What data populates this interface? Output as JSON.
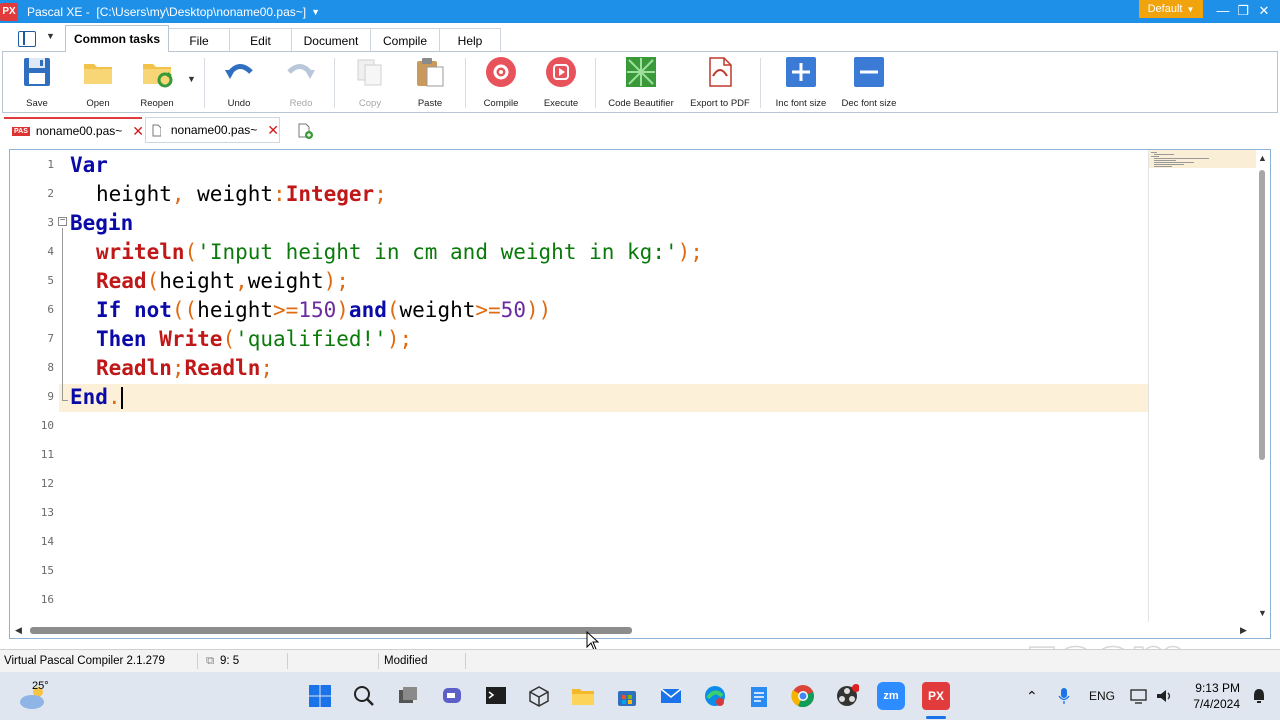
{
  "window": {
    "logo": "PX",
    "app_name": "Pascal XE",
    "path": "[C:\\Users\\my\\Desktop\\noname00.pas~]",
    "theme": "Default"
  },
  "ribbon_tabs": [
    "Common tasks",
    "File",
    "Edit",
    "Document",
    "Compile",
    "Help"
  ],
  "toolbar": {
    "save": "Save",
    "open": "Open",
    "reopen": "Reopen",
    "undo": "Undo",
    "redo": "Redo",
    "copy": "Copy",
    "paste": "Paste",
    "compile": "Compile",
    "execute": "Execute",
    "beautifier": "Code Beautifier",
    "export_pdf": "Export to PDF",
    "inc_font": "Inc font size",
    "dec_font": "Dec font size"
  },
  "doc_tabs": [
    {
      "label": "noname00.pas~",
      "active": true,
      "badge": "PAS"
    },
    {
      "label": "noname00.pas~",
      "active": false
    }
  ],
  "editor": {
    "line_numbers": [
      "1",
      "2",
      "3",
      "4",
      "5",
      "6",
      "7",
      "8",
      "9",
      "10",
      "11",
      "12",
      "13",
      "14",
      "15",
      "16"
    ],
    "code": {
      "l1": "Var",
      "l2_a": "height",
      "l2_b": ",",
      "l2_c": " weight",
      "l2_d": ":",
      "l2_e": "Integer",
      "l2_f": ";",
      "l3": "Begin",
      "l4_a": "writeln",
      "l4_b": "(",
      "l4_c": "'Input height in cm and weight in kg:'",
      "l4_d": ");",
      "l5_a": "Read",
      "l5_b": "(",
      "l5_c": "height",
      "l5_d": ",",
      "l5_e": "weight",
      "l5_f": ");",
      "l6_a": "If",
      "l6_b": " not",
      "l6_c": "((",
      "l6_d": "height",
      "l6_e": ">=",
      "l6_f": "150",
      "l6_g": ")",
      "l6_h": "and",
      "l6_i": "(",
      "l6_j": "weight",
      "l6_k": ">=",
      "l6_l": "50",
      "l6_m": "))",
      "l7_a": "Then",
      "l7_b": " Write",
      "l7_c": "(",
      "l7_d": "'qualified!'",
      "l7_e": ");",
      "l8_a": "Readln",
      "l8_b": ";",
      "l8_c": "Readln",
      "l8_d": ";",
      "l9_a": "End",
      "l9_b": "."
    }
  },
  "status": {
    "compiler": "Virtual Pascal Compiler 2.1.279",
    "position": "9: 5",
    "state": "Modified"
  },
  "watermark": "zoom",
  "taskbar": {
    "weather": "25°",
    "zoom_app": "zm",
    "pascal_app": "PX",
    "lang": "ENG",
    "time": "9:13 PM",
    "date": "7/4/2024"
  }
}
